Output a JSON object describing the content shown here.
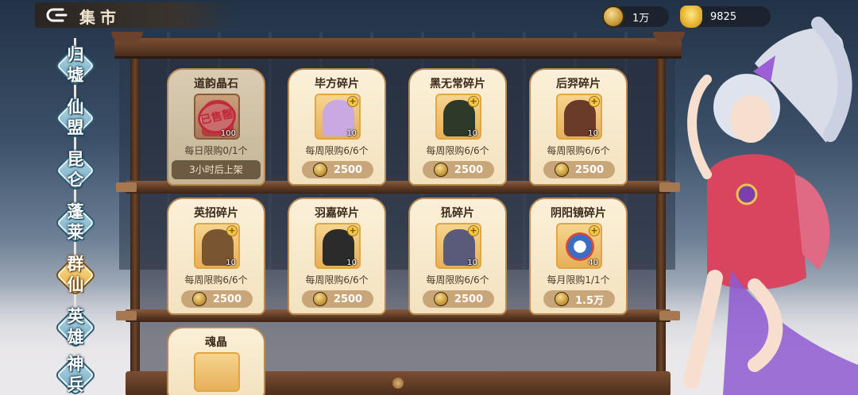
{
  "header": {
    "title": "集市",
    "back_icon": "back-arrow-icon"
  },
  "currencies": [
    {
      "icon": "token-icon",
      "value": "1万"
    },
    {
      "icon": "gold-ingot-icon",
      "value": "9825"
    }
  ],
  "nav": {
    "items": [
      {
        "label": "归墟",
        "active": false
      },
      {
        "label": "仙盟",
        "active": false
      },
      {
        "label": "昆仑",
        "active": false
      },
      {
        "label": "蓬莱",
        "active": false
      },
      {
        "label": "群仙",
        "active": true
      },
      {
        "label": "英雄",
        "active": false
      },
      {
        "label": "神兵",
        "active": false
      }
    ]
  },
  "shop": {
    "items": [
      {
        "name": "道韵晶石",
        "qty": "100",
        "limit": "每日限购0/1个",
        "sold_out": true,
        "stamp": "已售罄",
        "restock": "3小时后上架",
        "art_color": "#b63b3b"
      },
      {
        "name": "毕方碎片",
        "qty": "10",
        "limit": "每周限购6/6个",
        "price": "2500",
        "art_color": "#c9a9e0"
      },
      {
        "name": "黑无常碎片",
        "qty": "10",
        "limit": "每周限购6/6个",
        "price": "2500",
        "art_color": "#2d3a2a"
      },
      {
        "name": "后羿碎片",
        "qty": "10",
        "limit": "每周限购6/6个",
        "price": "2500",
        "art_color": "#6b3b2a"
      },
      {
        "name": "英招碎片",
        "qty": "10",
        "limit": "每周限购6/6个",
        "price": "2500",
        "art_color": "#7a5532"
      },
      {
        "name": "羽嘉碎片",
        "qty": "10",
        "limit": "每周限购6/6个",
        "price": "2500",
        "art_color": "#2b2b2b"
      },
      {
        "name": "犼碎片",
        "qty": "10",
        "limit": "每周限购6/6个",
        "price": "2500",
        "art_color": "#5a5a7a"
      },
      {
        "name": "阴阳镜碎片",
        "qty": "40",
        "limit": "每月限购1/1个",
        "price": "1.5万",
        "art_color": "#3d6cc4"
      },
      {
        "name": "魂晶",
        "partial": true
      }
    ]
  }
}
